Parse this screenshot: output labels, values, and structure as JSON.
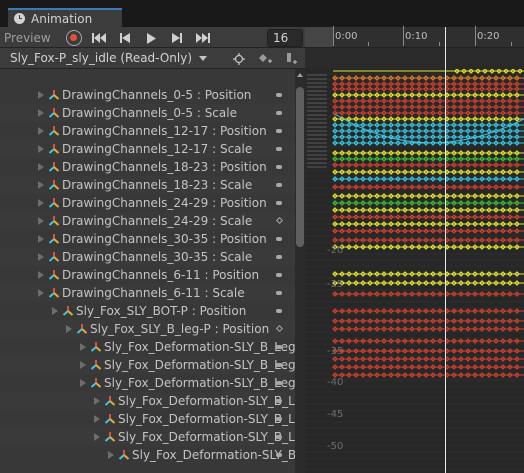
{
  "window": {
    "tab_title": "Animation"
  },
  "toolbar": {
    "preview_label": "Preview",
    "record_icon": "record-icon",
    "frame_value": "16"
  },
  "ruler": {
    "labels": [
      "0:00",
      "0:10",
      "0:20"
    ]
  },
  "clip": {
    "name": "Sly_Fox-P_sly_idle (Read-Only)"
  },
  "properties": [
    "DrawingChannels_0-5 : Position",
    "DrawingChannels_0-5 : Scale",
    "DrawingChannels_12-17 : Position",
    "DrawingChannels_12-17 : Scale",
    "DrawingChannels_18-23 : Position",
    "DrawingChannels_18-23 : Scale",
    "DrawingChannels_24-29 : Position",
    "DrawingChannels_24-29 : Scale",
    "DrawingChannels_30-35 : Position",
    "DrawingChannels_30-35 : Scale",
    "DrawingChannels_6-11 : Position",
    "DrawingChannels_6-11 : Scale",
    "Sly_Fox_SLY_BOT-P : Position",
    "Sly_Fox_SLY_B_leg-P : Position",
    "Sly_Fox_Deformation-SLY_B_Leg",
    "Sly_Fox_Deformation-SLY_B_Leg",
    "Sly_Fox_Deformation-SLY_B_Leg",
    "Sly_Fox_Deformation-SLY_B_L",
    "Sly_Fox_Deformation-SLY_B_L",
    "Sly_Fox_Deformation-SLY_B_L",
    "Sly_Fox_Deformation-SLY_B"
  ],
  "curve_axis": {
    "labels": [
      "-20",
      "-25",
      "-35",
      "-40",
      "-45",
      "-50"
    ]
  },
  "colors": {
    "yellow": "#e6e62e",
    "red": "#d2402f",
    "cyan": "#36c8e6",
    "green": "#39c02e",
    "orange": "#e07a28"
  }
}
